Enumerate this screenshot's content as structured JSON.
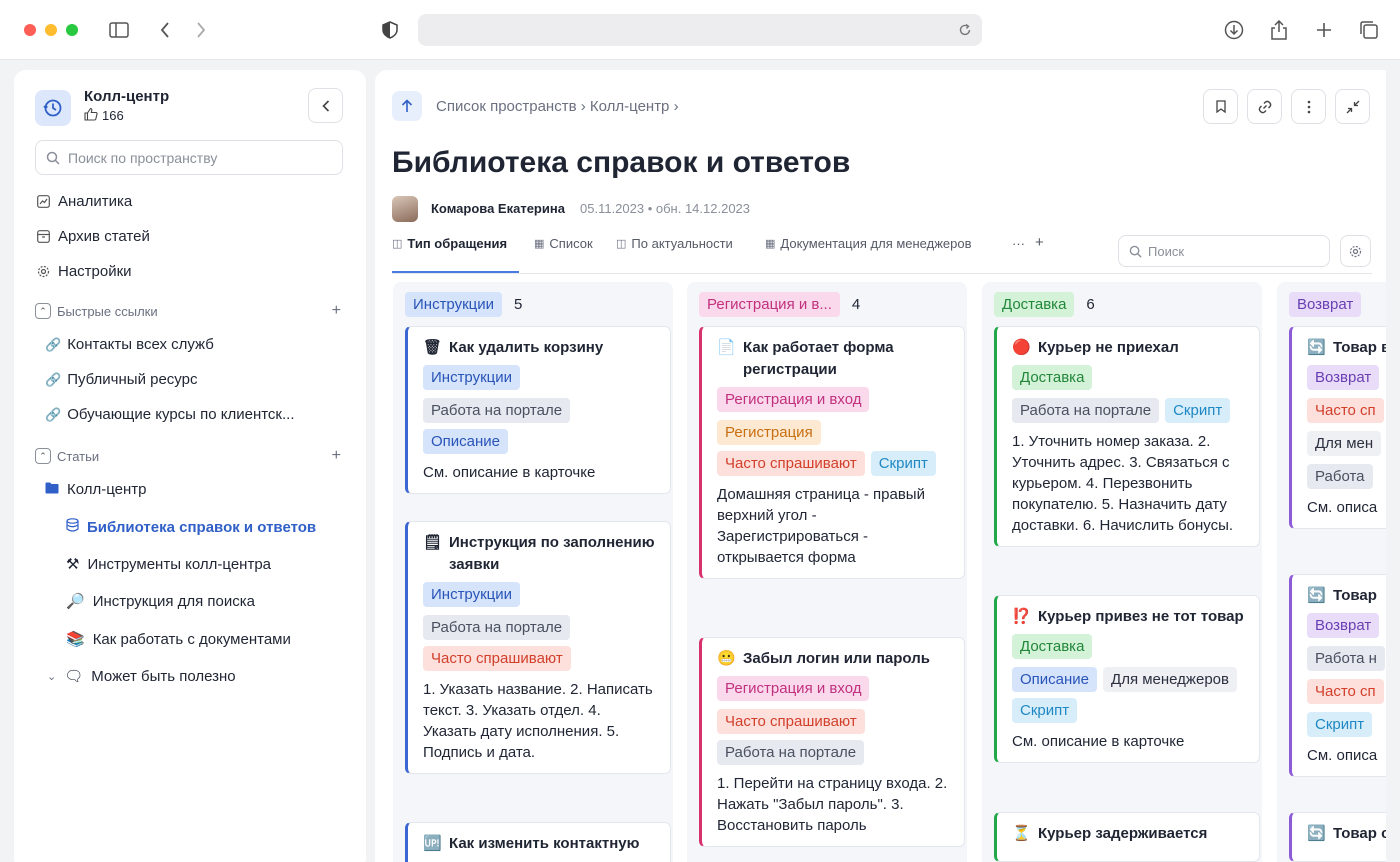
{
  "browser": {
    "icons": [
      "sidebar-toggle-icon",
      "back-icon",
      "forward-icon",
      "shield-icon",
      "reload-icon",
      "download-icon",
      "share-icon",
      "new-tab-icon",
      "tabs-overview-icon"
    ]
  },
  "sidebar": {
    "space_title": "Колл-центр",
    "likes": "166",
    "search_placeholder": "Поиск по пространству",
    "nav": [
      {
        "label": "Аналитика",
        "icon": "chart-icon"
      },
      {
        "label": "Архив статей",
        "icon": "archive-icon"
      },
      {
        "label": "Настройки",
        "icon": "gear-icon"
      }
    ],
    "quick_links_label": "Быстрые ссылки",
    "links": [
      "Контакты всех служб",
      "Публичный ресурс",
      "Обучающие курсы по клиентск..."
    ],
    "articles_label": "Статьи",
    "tree": [
      {
        "label": "Колл-центр",
        "icon": "📁"
      },
      {
        "label": "Библиотека справок и ответов",
        "icon": "🛢"
      },
      {
        "label": "Инструменты колл-центра",
        "icon": "⚒"
      },
      {
        "label": "Инструкция для поиска",
        "icon": "🔎"
      },
      {
        "label": "Как работать с документами",
        "icon": "📚"
      },
      {
        "label": "Может быть полезно",
        "icon": "🗨"
      }
    ]
  },
  "header": {
    "breadcrumb": "Список пространств › Колл-центр ›",
    "title": "Библиотека справок и ответов",
    "author": "Комарова Екатерина",
    "dates": "05.11.2023 • обн. 14.12.2023"
  },
  "tabs": [
    {
      "label": "Тип обращения"
    },
    {
      "label": "Список"
    },
    {
      "label": "По актуальности"
    },
    {
      "label": "Документация для менеджеров"
    },
    {
      "label": "···"
    },
    {
      "label": "+"
    }
  ],
  "tab_search_placeholder": "Поиск",
  "columns": [
    {
      "title": "Инструкции",
      "count": "5",
      "cards": [
        {
          "emoji": "🗑",
          "title": "Как удалить корзину",
          "tags": [
            "Инструкции",
            "Работа на портале",
            "Описание"
          ],
          "desc": "См. описание в карточке"
        },
        {
          "emoji": "🗒",
          "title": "Инструкция по заполнению заявки",
          "tags": [
            "Инструкции",
            "Работа на портале",
            "Часто спрашивают"
          ],
          "desc": "1. Указать название. 2. Написать текст. 3. Указать отдел. 4. Указать дату исполнения. 5. Подпись и дата."
        },
        {
          "emoji": "🆙",
          "title": "Как изменить контактную",
          "tags": [],
          "desc": ""
        }
      ]
    },
    {
      "title": "Регистрация и в...",
      "count": "4",
      "cards": [
        {
          "emoji": "📄",
          "title": "Как работает форма регистрации",
          "tags": [
            "Регистрация и вход",
            "Регистрация",
            "Часто спрашивают",
            "Скрипт"
          ],
          "desc": "Домашняя страница - правый верхний угол - Зарегистрироваться - открывается форма"
        },
        {
          "emoji": "😬",
          "title": "Забыл логин или пароль",
          "tags": [
            "Регистрация и вход",
            "Часто спрашивают",
            "Работа на портале"
          ],
          "desc": "1. Перейти на страницу входа. 2. Нажать \"Забыл пароль\". 3. Восстановить пароль"
        }
      ]
    },
    {
      "title": "Доставка",
      "count": "6",
      "cards": [
        {
          "emoji": "🔴",
          "title": "Курьер не приехал",
          "tags": [
            "Доставка",
            "Работа на портале",
            "Скрипт"
          ],
          "desc": "1. Уточнить номер заказа. 2. Уточнить адрес. 3. Связаться с курьером. 4. Перезвонить покупателю. 5. Назначить дату доставки. 6. Начислить бонусы."
        },
        {
          "emoji": "⁉️",
          "title": "Курьер привез не тот товар",
          "tags": [
            "Доставка",
            "Описание",
            "Для менеджеров",
            "Скрипт"
          ],
          "desc": "См. описание в карточке"
        },
        {
          "emoji": "⏳",
          "title": "Курьер задерживается",
          "tags": [],
          "desc": ""
        }
      ]
    },
    {
      "title": "Возврат",
      "count": "",
      "cards": [
        {
          "emoji": "🔄",
          "title": "Товар верну",
          "tags": [
            "Возврат",
            "Часто сп",
            "Для мен",
            "Работа"
          ],
          "desc": "См. описа"
        },
        {
          "emoji": "🔄",
          "title": "Товар",
          "tags": [
            "Возврат",
            "Работа н",
            "Часто сп",
            "Скрипт"
          ],
          "desc": "См. описа"
        },
        {
          "emoji": "🔄",
          "title": "Товар соотве",
          "tags": [],
          "desc": ""
        }
      ]
    }
  ]
}
